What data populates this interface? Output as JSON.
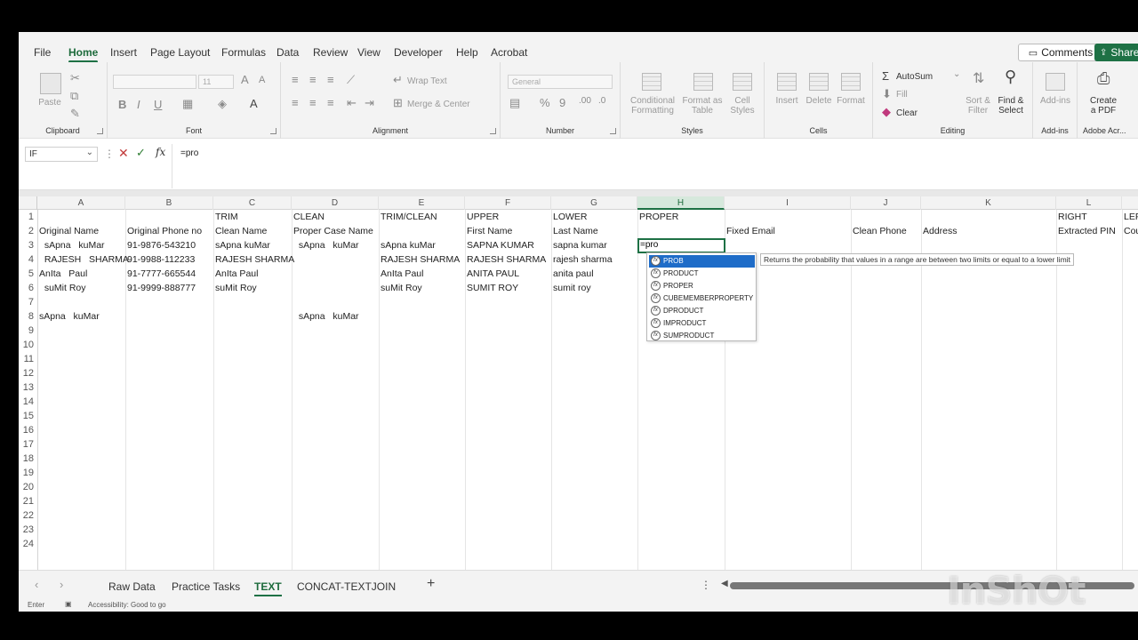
{
  "ribbon_tabs": [
    "File",
    "Home",
    "Insert",
    "Page Layout",
    "Formulas",
    "Data",
    "Review",
    "View",
    "Developer",
    "Help",
    "Acrobat"
  ],
  "active_tab": "Home",
  "comments_label": "Comments",
  "share_label": "Share",
  "ribbon": {
    "clipboard": {
      "label": "Clipboard",
      "paste": "Paste"
    },
    "font": {
      "label": "Font",
      "font_name": "",
      "font_size": "11"
    },
    "alignment": {
      "label": "Alignment",
      "wrap_text": "Wrap Text",
      "merge_center": "Merge & Center"
    },
    "number": {
      "label": "Number",
      "format": "General"
    },
    "styles": {
      "label": "Styles",
      "conditional_1": "Conditional",
      "conditional_2": "Formatting",
      "format_as_1": "Format as",
      "format_as_2": "Table",
      "cell_styles_1": "Cell",
      "cell_styles_2": "Styles"
    },
    "cells": {
      "label": "Cells",
      "insert": "Insert",
      "delete": "Delete",
      "format": "Format"
    },
    "editing": {
      "label": "Editing",
      "autosum": "AutoSum",
      "fill": "Fill",
      "clear": "Clear",
      "sort_1": "Sort &",
      "sort_2": "Filter",
      "find_1": "Find &",
      "find_2": "Select"
    },
    "addins": {
      "label": "Add-ins",
      "addins": "Add-ins"
    },
    "adobe": {
      "label": "Adobe Acr...",
      "create_1": "Create",
      "create_2": "a PDF"
    }
  },
  "formula_bar": {
    "name_box": "IF",
    "formula": "=pro"
  },
  "columns": [
    "A",
    "B",
    "C",
    "D",
    "E",
    "F",
    "G",
    "H",
    "I",
    "J",
    "K",
    "L"
  ],
  "selected_column": "H",
  "rows": [
    "1",
    "2",
    "3",
    "4",
    "5",
    "6",
    "7",
    "8",
    "9",
    "10",
    "11",
    "12",
    "13",
    "14",
    "15",
    "16",
    "17",
    "18",
    "19",
    "20",
    "21",
    "22",
    "23",
    "24"
  ],
  "cells": {
    "C1": "TRIM",
    "D1": "CLEAN",
    "E1": "TRIM/CLEAN",
    "F1": "UPPER",
    "G1": "LOWER",
    "H1": "PROPER",
    "L1": "RIGHT",
    "M1": "LEF",
    "A2": "Original Name",
    "B2": "Original Phone no",
    "C2": "Clean Name",
    "D2": "Proper Case Name",
    "F2": "First Name",
    "G2": "Last Name",
    "I2": "Fixed Email",
    "J2": "Clean Phone",
    "K2": "Address",
    "L2": "Extracted PIN",
    "M2": "Cou",
    "A3": "  sApna   kuMar",
    "B3": "91-9876-543210",
    "C3": "sApna kuMar",
    "D3": "  sApna   kuMar",
    "E3": "sApna kuMar",
    "F3": "SAPNA KUMAR",
    "G3": "sapna kumar",
    "A4": "  RAJESH   SHARMA",
    "B4": "91-9988-112233",
    "C4": "RAJESH SHARMA",
    "E4": "RAJESH SHARMA",
    "F4": "RAJESH SHARMA",
    "G4": "rajesh sharma",
    "A5": "AnIta   Paul",
    "B5": "91-7777-665544",
    "C5": "AnIta Paul",
    "E5": "AnIta Paul",
    "F5": "ANITA PAUL",
    "G5": "anita paul",
    "A6": "  suMit Roy",
    "B6": "91-9999-888777",
    "C6": "suMit Roy",
    "E6": "suMit Roy",
    "F6": "SUMIT ROY",
    "G6": "sumit roy",
    "A8": "sApna   kuMar",
    "D8": "  sApna   kuMar"
  },
  "active_cell_value": "=pro",
  "autocomplete": [
    "PROB",
    "PRODUCT",
    "PROPER",
    "CUBEMEMBERPROPERTY",
    "DPRODUCT",
    "IMPRODUCT",
    "SUMPRODUCT"
  ],
  "tooltip": "Returns the probability that values in a range are between two limits or equal to a lower limit",
  "sheets": [
    "Raw Data",
    "Practice Tasks",
    "TEXT",
    "CONCAT-TEXTJOIN"
  ],
  "active_sheet": "TEXT",
  "status": {
    "mode": "Enter",
    "accessibility": "Accessibility: Good to go"
  },
  "watermark": "InShOt",
  "colors": {
    "accent": "#1e7145",
    "selection": "#1e6cc8"
  }
}
